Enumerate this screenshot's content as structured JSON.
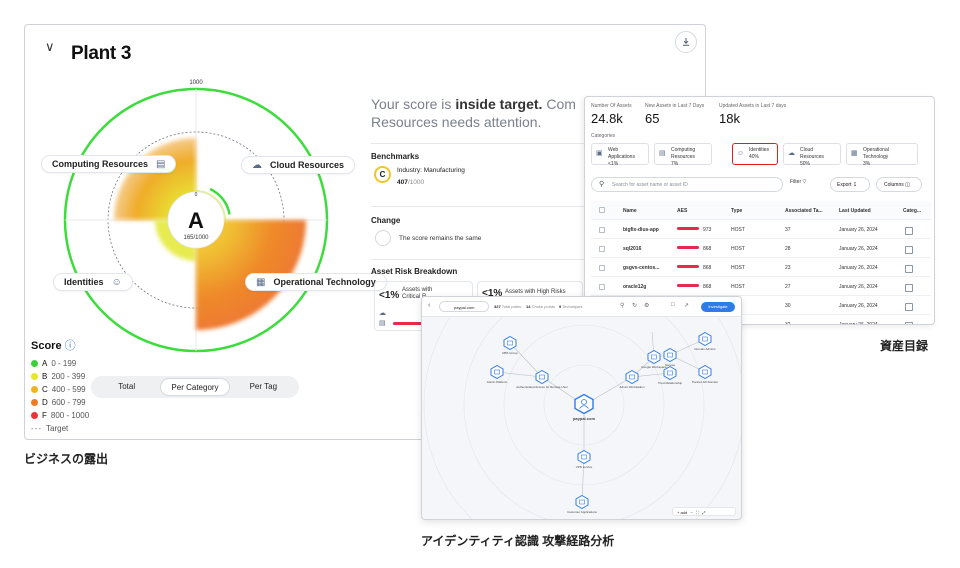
{
  "plant": {
    "title": "Plant 3",
    "scale_max": "1000",
    "scale_zero": "0",
    "grade": "A",
    "score_text": "165/1000",
    "categories": {
      "computing": "Computing Resources",
      "cloud": "Cloud Resources",
      "identities": "Identities",
      "ot": "Operational Technology"
    },
    "message_pre": "Your score is ",
    "message_bold": "inside target.",
    "message_post": " Com",
    "message_line2": "Resources needs attention.",
    "benchmarks_title": "Benchmarks",
    "benchmark_grade": "C",
    "benchmark_industry": "Industry: Manufacturing",
    "benchmark_score": "407",
    "benchmark_max": "/1000",
    "change_title": "Change",
    "change_text": "The score remains the same",
    "risk_title": "Asset Risk Breakdown",
    "risk1_pct": "<1%",
    "risk1_l1": "Assets with",
    "risk1_l2": "Critical R",
    "risk2_pct": "<1%",
    "risk2_l1": "Assets with High Risks",
    "legend_title": "Score",
    "legend": [
      {
        "letter": "A",
        "range": "0 - 199",
        "color": "#3ccf3c"
      },
      {
        "letter": "B",
        "range": "200 - 399",
        "color": "#e6e62a"
      },
      {
        "letter": "C",
        "range": "400 - 599",
        "color": "#f0b224"
      },
      {
        "letter": "D",
        "range": "600 - 799",
        "color": "#ee7a22"
      },
      {
        "letter": "F",
        "range": "800 - 1000",
        "color": "#e8323c"
      }
    ],
    "legend_target": "Target",
    "tabs": [
      "Total",
      "Per Category",
      "Per Tag"
    ],
    "active_tab": "Per Category"
  },
  "assets": {
    "stats": [
      {
        "label": "Number Of Assets",
        "value": "24.8k"
      },
      {
        "label": "New Assets in Last 7 Days",
        "value": "65"
      },
      {
        "label": "Updated Assets in Last 7 days",
        "value": "18k"
      }
    ],
    "categories_label": "Categories",
    "cards": [
      {
        "name": "Web Applications",
        "pct": "<1%"
      },
      {
        "name": "Computing Resources",
        "pct": "7%"
      },
      {
        "name": "Identities",
        "pct": "40%"
      },
      {
        "name": "Cloud Resources",
        "pct": "50%"
      },
      {
        "name": "Operational Technology",
        "pct": "3%"
      }
    ],
    "search_placeholder": "Search for asset name or asset ID",
    "filter": "Filter",
    "export": "Export",
    "columns": "Columns",
    "headers": [
      "Name",
      "AES",
      "Type",
      "Associated Ta...",
      "Last Updated",
      "Categ..."
    ],
    "rows": [
      {
        "name": "bigfix-dius-app",
        "aes": "973",
        "type": "HOST",
        "tags": "37",
        "updated": "January 26, 2024"
      },
      {
        "name": "sql2016",
        "aes": "868",
        "type": "HOST",
        "tags": "28",
        "updated": "January 26, 2024"
      },
      {
        "name": "gsgvs-centos...",
        "aes": "868",
        "type": "HOST",
        "tags": "23",
        "updated": "January 26, 2024"
      },
      {
        "name": "oracle12g",
        "aes": "868",
        "type": "HOST",
        "tags": "27",
        "updated": "January 26, 2024"
      },
      {
        "name": "",
        "aes": "",
        "type": "",
        "tags": "30",
        "updated": "January 26, 2024"
      },
      {
        "name": "",
        "aes": "",
        "type": "",
        "tags": "32",
        "updated": "January 26, 2024"
      }
    ]
  },
  "graph": {
    "address": "paypal.com",
    "stats": [
      {
        "value": "327",
        "label": "Total paths"
      },
      {
        "value": "14",
        "label": "Choke points"
      },
      {
        "value": "9",
        "label": "Techniques"
      }
    ],
    "investigate": "Investigate",
    "center": "paypal.com",
    "nodes": [
      "RBS Group",
      "Admin Platform",
      "Authenticated Access for Remote User",
      "Admin Workstation",
      "Google Workspace",
      "Domain Admins",
      "Service",
      "Partner AD Domain",
      "Trust Relationship",
      "VPN service",
      "Customer Applications"
    ],
    "zoom_label": "+ add"
  },
  "captions": {
    "exposure": "ビジネスの露出",
    "catalog": "資産目録",
    "identity": "アイデンティティ認識 攻撃経路分析"
  }
}
